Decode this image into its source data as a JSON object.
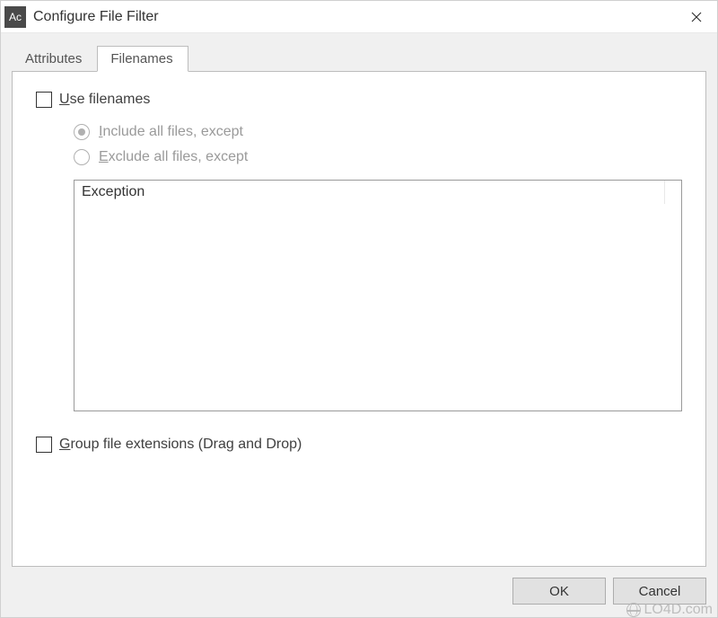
{
  "window": {
    "app_icon_text": "Ac",
    "title": "Configure File Filter"
  },
  "tabs": {
    "attributes": "Attributes",
    "filenames": "Filenames"
  },
  "panel": {
    "use_filenames_prefix": "U",
    "use_filenames_rest": "se filenames",
    "radio_include_prefix": "I",
    "radio_include_rest": "nclude all files, except",
    "radio_exclude_prefix": "E",
    "radio_exclude_rest": "xclude all files, except",
    "exception_header": "Exception",
    "group_ext_prefix": "G",
    "group_ext_rest": "roup file extensions (Drag and Drop)"
  },
  "buttons": {
    "ok": "OK",
    "cancel": "Cancel"
  },
  "watermark": "LO4D.com"
}
